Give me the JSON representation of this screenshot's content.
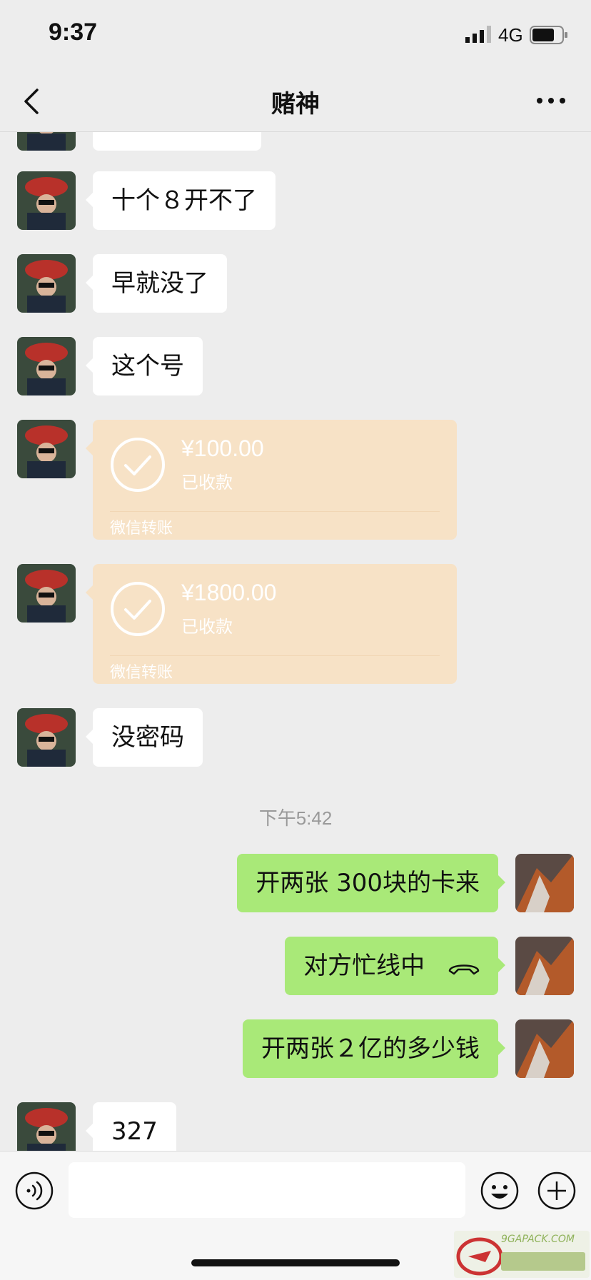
{
  "status_bar": {
    "time": "9:37",
    "network": "4G"
  },
  "nav": {
    "title": "赌神"
  },
  "messages": {
    "m1": "十个８开不了",
    "m2": "早就没了",
    "m3": "这个号",
    "t1": {
      "amount": "¥100.00",
      "status": "已收款",
      "label": "微信转账"
    },
    "t2": {
      "amount": "¥1800.00",
      "status": "已收款",
      "label": "微信转账"
    },
    "m4": "没密码",
    "timestamp": "下午5:42",
    "r1": "开两张 300块的卡来",
    "r2": "对方忙线中",
    "r3": "开两张２亿的多少钱",
    "m5": "327"
  },
  "watermark": {
    "text": "9GAPACK.COM"
  },
  "colors": {
    "background": "#ededed",
    "sent_bubble": "#a9e978",
    "received_bubble": "#ffffff",
    "transfer_bubble": "#f7e2c6"
  }
}
